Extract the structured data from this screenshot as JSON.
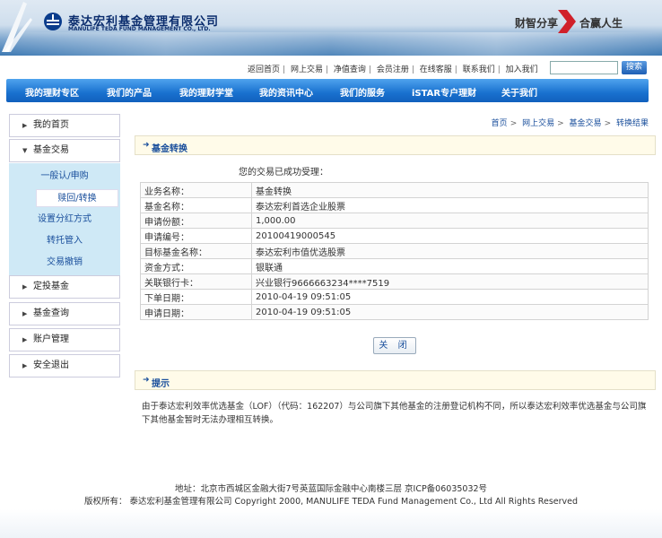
{
  "header": {
    "company_cn": "泰达宏利基金管理有限公司",
    "company_en": "MANULIFE TEDA FUND MANAGEMENT CO., LTD.",
    "slogan_left": "财智分享",
    "slogan_right": "合赢人生"
  },
  "top_links": [
    "返回首页",
    "网上交易",
    "净值查询",
    "会员注册",
    "在线客服",
    "联系我们",
    "加入我们"
  ],
  "search": {
    "placeholder": "",
    "button_label": "搜索"
  },
  "nav": [
    "我的理财专区",
    "我们的产品",
    "我的理财学堂",
    "我的资讯中心",
    "我们的服务",
    "iSTAR专户理财",
    "关于我们"
  ],
  "sidebar": {
    "my_home": "我的首页",
    "fund_trade": "基金交易",
    "sub_items": [
      "一般认/申购",
      "赎回/转换",
      "设置分红方式",
      "转托管入",
      "交易撤销"
    ],
    "others": [
      "定投基金",
      "基金查询",
      "账户管理",
      "安全退出"
    ]
  },
  "breadcrumb": [
    "首页",
    "网上交易",
    "基金交易",
    "转换结果"
  ],
  "section_title": "基金转换",
  "success_msg": "您的交易已成功受理：",
  "details": [
    {
      "label": "业务名称：",
      "value": "基金转换"
    },
    {
      "label": "基金名称：",
      "value": "泰达宏利首选企业股票"
    },
    {
      "label": "申请份额：",
      "value": "1,000.00"
    },
    {
      "label": "申请编号：",
      "value": "20100419000545"
    },
    {
      "label": "目标基金名称：",
      "value": "泰达宏利市值优选股票"
    },
    {
      "label": "资金方式：",
      "value": "银联通"
    },
    {
      "label": "关联银行卡：",
      "value": "兴业银行9666663234****7519"
    },
    {
      "label": "下单日期：",
      "value": "2010-04-19 09:51:05"
    },
    {
      "label": "申请日期：",
      "value": "2010-04-19 09:51:05"
    }
  ],
  "close_label": "关 闭",
  "tip_title": "提示",
  "tip_text": "由于泰达宏利效率优选基金（LOF）（代码：162207）与公司旗下其他基金的注册登记机构不同，所以泰达宏利效率优选基金与公司旗下其他基金暂时无法办理相互转换。",
  "footer": {
    "address": "地址：北京市西城区金融大街7号英蓝国际金融中心南楼三层 京ICP备06035032号",
    "copyright": "版权所有： 泰达宏利基金管理有限公司 Copyright 2000, MANULIFE TEDA Fund Management Co., Ltd All Rights Reserved"
  },
  "colors": {
    "nav_blue": "#1971cf",
    "link_blue": "#1a4f9c",
    "brand_red": "#d0202a"
  }
}
